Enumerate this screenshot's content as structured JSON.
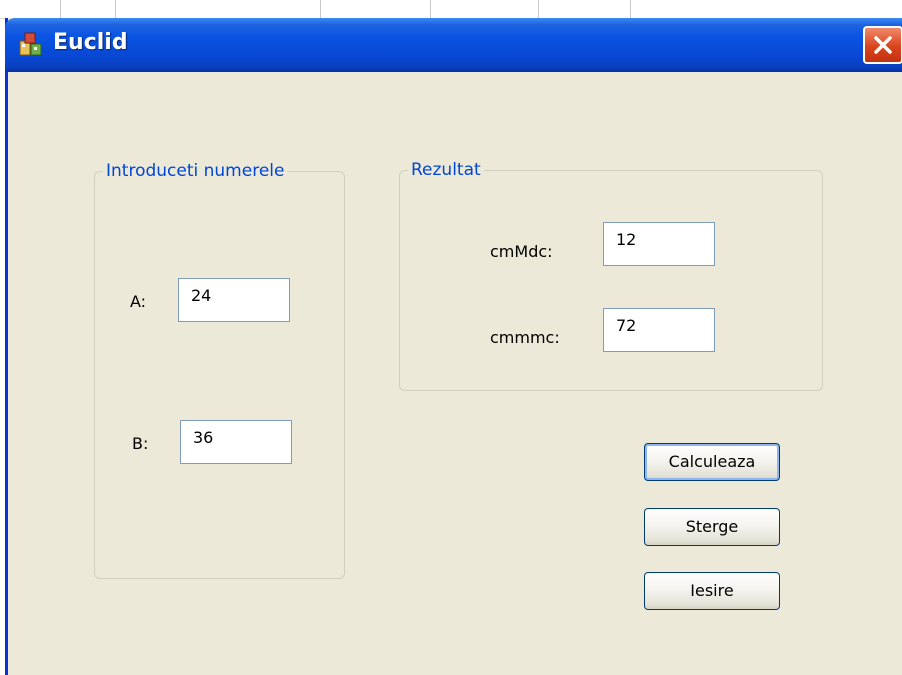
{
  "window": {
    "title": "Euclid",
    "app_icon": "app-icon",
    "close_icon": "close-icon"
  },
  "input_group": {
    "title": "Introduceti numerele",
    "a_label": "A:",
    "a_value": "24",
    "b_label": "B:",
    "b_value": "36"
  },
  "result_group": {
    "title": "Rezultat",
    "gcd_label": "cmMdc:",
    "gcd_value": "12",
    "lcm_label": "cmmmc:",
    "lcm_value": "72"
  },
  "buttons": {
    "calculate": "Calculeaza",
    "clear": "Sterge",
    "exit": "Iesire"
  },
  "colors": {
    "titlebar": "#0a53e3",
    "window_bg": "#ece9d8",
    "group_title": "#0046d5",
    "close_button": "#d9441c"
  }
}
